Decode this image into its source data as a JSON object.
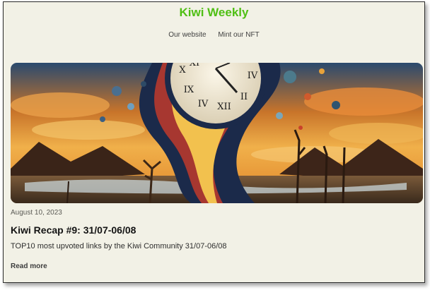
{
  "site": {
    "title": "Kiwi Weekly",
    "accent_color": "#4fbf14",
    "background_color": "#f2f1e6"
  },
  "nav": {
    "links": [
      {
        "label": "Our website"
      },
      {
        "label": "Mint our NFT"
      }
    ]
  },
  "post": {
    "image_icon": "surreal-melting-clock-landscape",
    "date": "August 10, 2023",
    "title": "Kiwi Recap #9: 31/07-06/08",
    "excerpt": "TOP10 most upvoted links by the Kiwi Community 31/07-06/08",
    "read_more_label": "Read more"
  }
}
